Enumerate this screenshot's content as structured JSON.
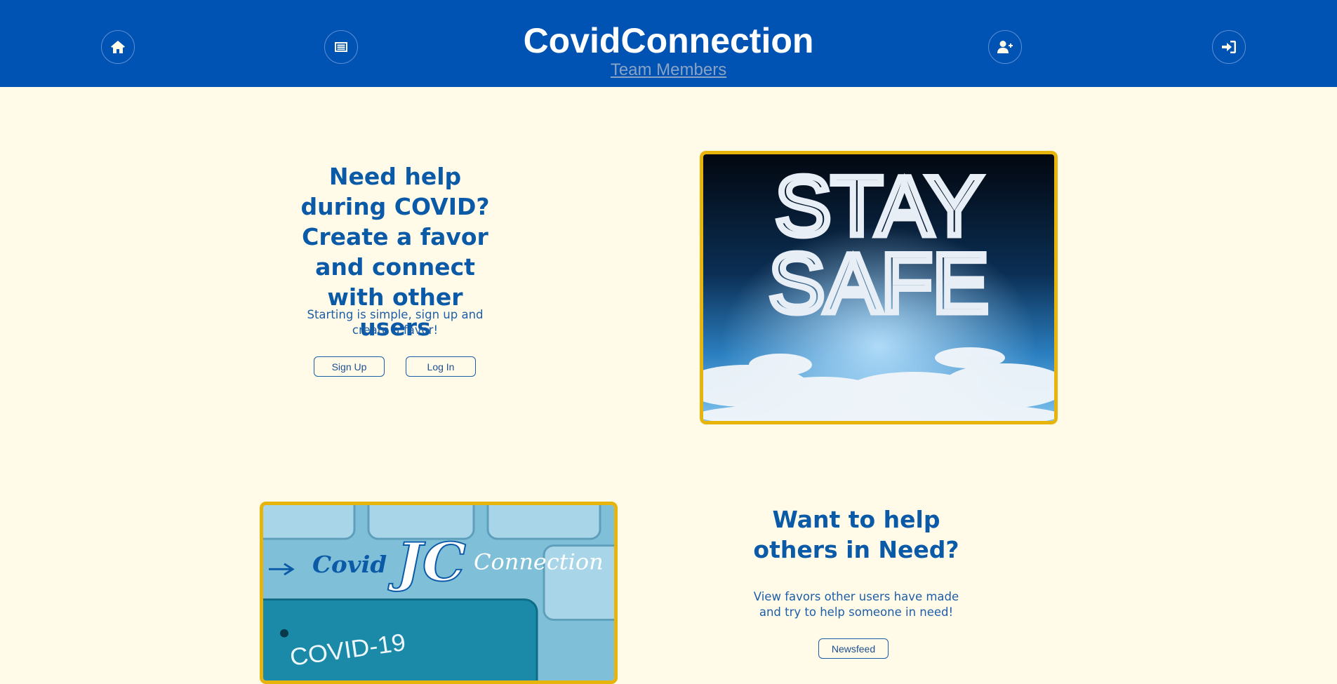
{
  "header": {
    "brand": "CovidConnection",
    "team_link": "Team Members",
    "nav": [
      {
        "name": "home",
        "icon": "home-icon"
      },
      {
        "name": "newsfeed",
        "icon": "newspaper-icon"
      },
      {
        "name": "sign-up",
        "icon": "user-plus-icon"
      },
      {
        "name": "log-in",
        "icon": "sign-in-icon"
      }
    ]
  },
  "hero": {
    "heading": "Need help during COVID? Create a favor and connect with other users",
    "subtext": "Starting is simple, sign up and create a favor!",
    "signup_label": "Sign Up",
    "login_label": "Log In",
    "image_text_line1": "STAY",
    "image_text_line2": "SAFE"
  },
  "help": {
    "heading": "Want to help others in Need?",
    "subtext": "View favors other users have made and try to help someone in need!",
    "newsfeed_label": "Newsfeed",
    "image_logo_left": "Covid",
    "image_logo_mark": "JC",
    "image_logo_right": "Connection",
    "image_key_text": "COVID-19"
  },
  "colors": {
    "header_bg": "#0053b3",
    "page_bg": "#fffbe8",
    "heading": "#0a5aa8",
    "frame": "#e6b40a"
  }
}
